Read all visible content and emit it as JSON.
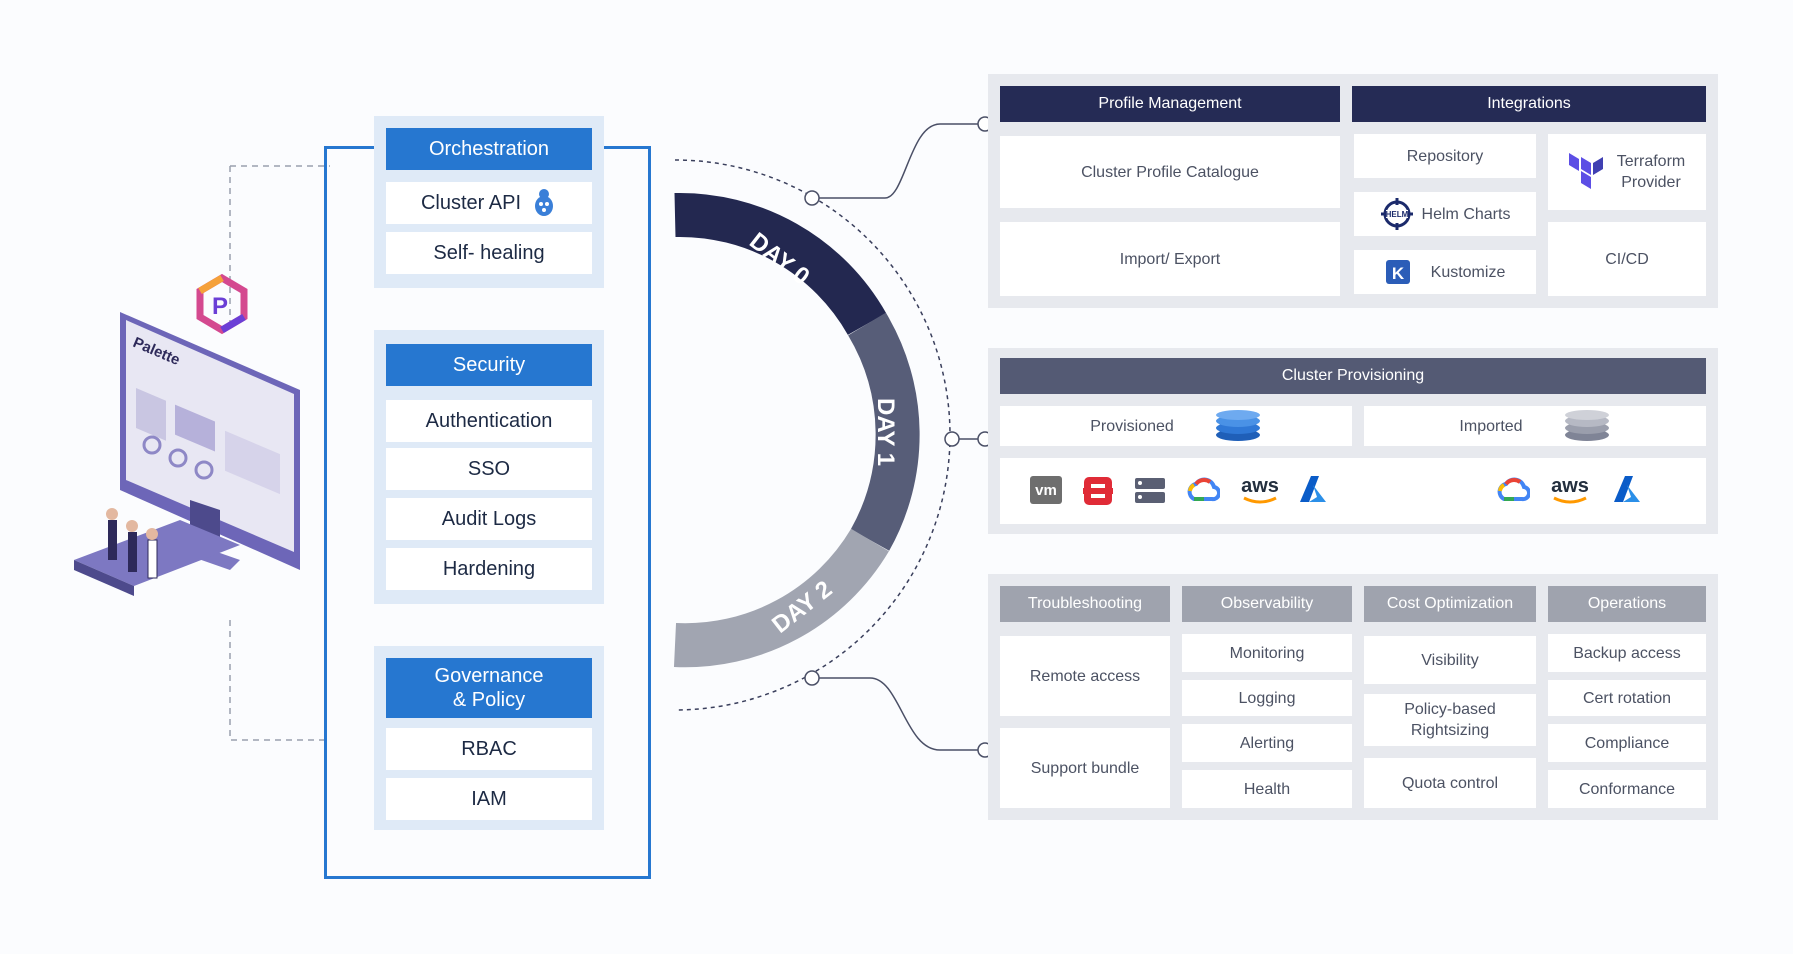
{
  "logo": {
    "brand_text": "Palette"
  },
  "left": {
    "orchestration": {
      "title": "Orchestration",
      "items": [
        "Cluster API",
        "Self- healing"
      ]
    },
    "security": {
      "title": "Security",
      "items": [
        "Authentication",
        "SSO",
        "Audit Logs",
        "Hardening"
      ]
    },
    "governance": {
      "title": "Governance\n& Policy",
      "items": [
        "RBAC",
        "IAM"
      ]
    }
  },
  "days": {
    "day0": "DAY 0",
    "day1": "DAY 1",
    "day2": "DAY 2"
  },
  "day0_panel": {
    "profile_management": {
      "title": "Profile  Management",
      "items": [
        "Cluster  Profile  Catalogue",
        "Import/  Export"
      ]
    },
    "integrations": {
      "title": "Integrations",
      "repository": "Repository",
      "helm": "Helm  Charts",
      "kustomize": "Kustomize",
      "terraform": "Terraform\nProvider",
      "cicd": "CI/CD"
    }
  },
  "day1_panel": {
    "title": "Cluster  Provisioning",
    "provisioned": "Provisioned",
    "imported": "Imported",
    "provisioned_providers": [
      "vmware-icon",
      "openstack-icon",
      "bare-metal-icon",
      "gcp-icon",
      "aws-icon",
      "azure-icon"
    ],
    "imported_providers": [
      "gcp-icon",
      "aws-icon",
      "azure-icon"
    ],
    "aws_label": "aws",
    "vm_label": "vm"
  },
  "day2_panel": {
    "troubleshooting": {
      "title": "Troubleshooting",
      "items": [
        "Remote access",
        "Support  bundle"
      ]
    },
    "observability": {
      "title": "Observability",
      "items": [
        "Monitoring",
        "Logging",
        "Alerting",
        "Health"
      ]
    },
    "cost": {
      "title": "Cost Optimization",
      "items": [
        "Visibility",
        "Policy-based\nRightsizing",
        "Quota  control"
      ]
    },
    "operations": {
      "title": "Operations",
      "items": [
        "Backup  access",
        "Cert  rotation",
        "Compliance",
        "Conformance"
      ]
    }
  },
  "colors": {
    "accent_blue": "#2677d0",
    "navy": "#252b55",
    "slate": "#545a74",
    "grey": "#9fa3ae",
    "panel_bg": "#e7e9ee",
    "ring_day0": "#232850",
    "ring_day1": "#575d78",
    "ring_day2": "#a1a5b1"
  }
}
